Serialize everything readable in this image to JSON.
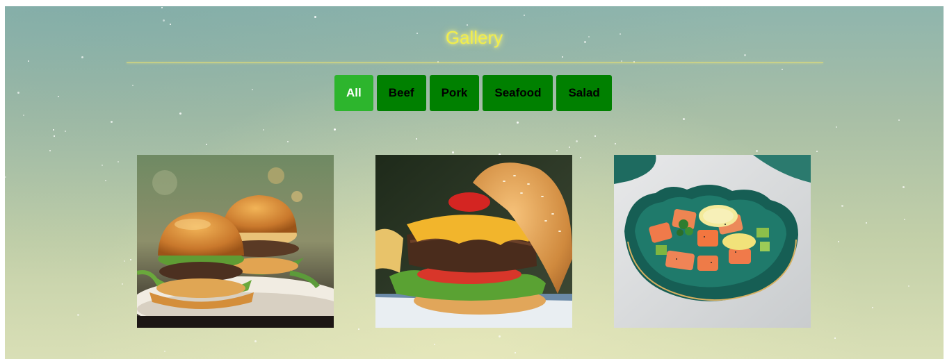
{
  "gallery": {
    "title": "Gallery",
    "filters": [
      {
        "label": "All",
        "active": true
      },
      {
        "label": "Beef",
        "active": false
      },
      {
        "label": "Pork",
        "active": false
      },
      {
        "label": "Seafood",
        "active": false
      },
      {
        "label": "Salad",
        "active": false
      }
    ],
    "items": [
      {
        "icon": "double-burgers-photo"
      },
      {
        "icon": "cheeseburger-photo"
      },
      {
        "icon": "salmon-bowl-photo"
      }
    ]
  },
  "colors": {
    "title": "#f2ee4a",
    "button": "#008000",
    "button_active": "#2db52d"
  }
}
